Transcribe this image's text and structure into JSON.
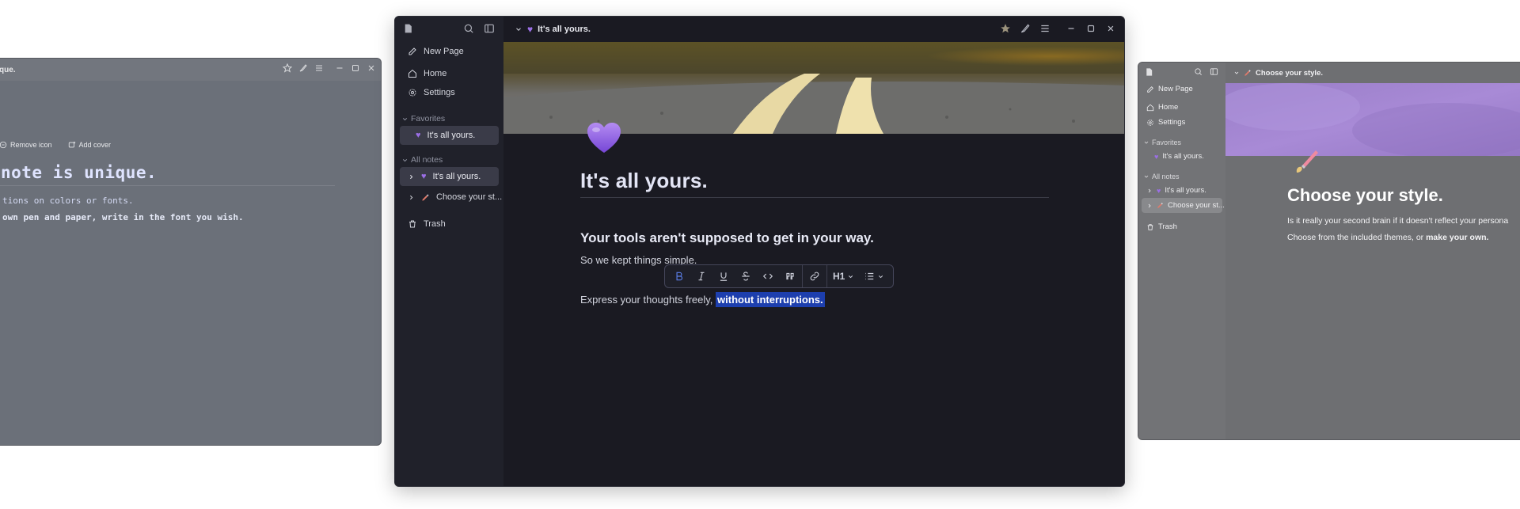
{
  "left_window": {
    "title": "que.",
    "actions": {
      "remove_icon": "Remove icon",
      "add_cover": "Add cover"
    },
    "heading": "note is unique.",
    "line1": "tions on colors or fonts.",
    "line2": "own pen and paper, write in the font you wish."
  },
  "main_window": {
    "title": "It's all yours.",
    "sidebar": {
      "items": [
        {
          "label": "New Page",
          "icon": "edit-icon"
        },
        {
          "label": "Home",
          "icon": "home-icon"
        },
        {
          "label": "Settings",
          "icon": "gear-icon"
        }
      ],
      "favorites_label": "Favorites",
      "favorites": [
        {
          "label": "It's all yours.",
          "icon": "purple-heart"
        }
      ],
      "all_notes_label": "All notes",
      "notes": [
        {
          "label": "It's all yours.",
          "icon": "purple-heart"
        },
        {
          "label": "Choose your st...",
          "icon": "paintbrush"
        }
      ],
      "trash_label": "Trash"
    },
    "document": {
      "title": "It's all yours.",
      "heading": "Your tools aren't supposed to get in your way.",
      "paragraph1": "So we kept things simple.",
      "paragraph2_plain": "Express your thoughts freely, ",
      "paragraph2_selected": "without interruptions."
    },
    "toolbar": {
      "heading_level": "H1",
      "buttons": [
        "bold",
        "italic",
        "underline",
        "strikethrough",
        "code",
        "quote",
        "link"
      ]
    }
  },
  "right_window": {
    "title": "Choose your style.",
    "sidebar": {
      "items": [
        {
          "label": "New Page",
          "icon": "edit-icon"
        },
        {
          "label": "Home",
          "icon": "home-icon"
        },
        {
          "label": "Settings",
          "icon": "gear-icon"
        }
      ],
      "favorites_label": "Favorites",
      "favorites": [
        {
          "label": "It's all yours."
        }
      ],
      "all_notes_label": "All notes",
      "notes": [
        {
          "label": "It's all yours."
        },
        {
          "label": "Choose your st..."
        }
      ],
      "trash_label": "Trash"
    },
    "document": {
      "title": "Choose your style.",
      "paragraph1": "Is it really your second brain if it doesn't reflect your persona",
      "paragraph2_plain": "Choose from the included themes, or ",
      "paragraph2_bold": "make your own."
    }
  },
  "colors": {
    "selection": "#1d3fae",
    "accent_bold": "#5b7ee8",
    "heart": "#9b6fe6",
    "main_bg": "#1a1a22"
  }
}
